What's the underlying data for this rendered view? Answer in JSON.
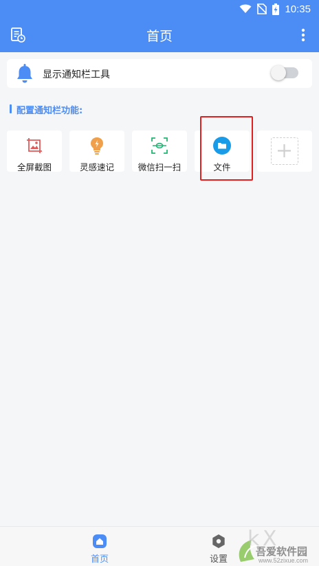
{
  "status_bar": {
    "time": "10:35",
    "icons": [
      "wifi-icon",
      "no-sim-icon",
      "battery-charging-icon"
    ]
  },
  "app_bar": {
    "title": "首页",
    "left_icon": "document-clock-icon",
    "right_icon": "more-vertical-icon"
  },
  "notification": {
    "icon": "bell-icon",
    "label": "显示通知栏工具",
    "enabled": false
  },
  "section": {
    "title": "配置通知栏功能:"
  },
  "tiles": [
    {
      "label": "全屏截图",
      "icon": "screenshot-icon",
      "color": "#e05a5a"
    },
    {
      "label": "灵感速记",
      "icon": "lightbulb-icon",
      "color": "#f0a04b"
    },
    {
      "label": "微信扫一扫",
      "icon": "scan-icon",
      "color": "#22b573"
    },
    {
      "label": "文件",
      "icon": "folder-icon",
      "color": "#1a9be8"
    },
    {
      "label": "",
      "icon": "add-icon",
      "color": "#cfcfcf"
    }
  ],
  "bottom_nav": {
    "items": [
      {
        "label": "首页",
        "icon": "home-icon",
        "active": true
      },
      {
        "label": "设置",
        "icon": "settings-icon",
        "active": false
      }
    ]
  },
  "watermark": {
    "text": "吾爱软件园",
    "url": "www.52zixue.com"
  },
  "colors": {
    "primary": "#4c8df5",
    "highlight": "#e02020",
    "background": "#f5f6f8"
  }
}
